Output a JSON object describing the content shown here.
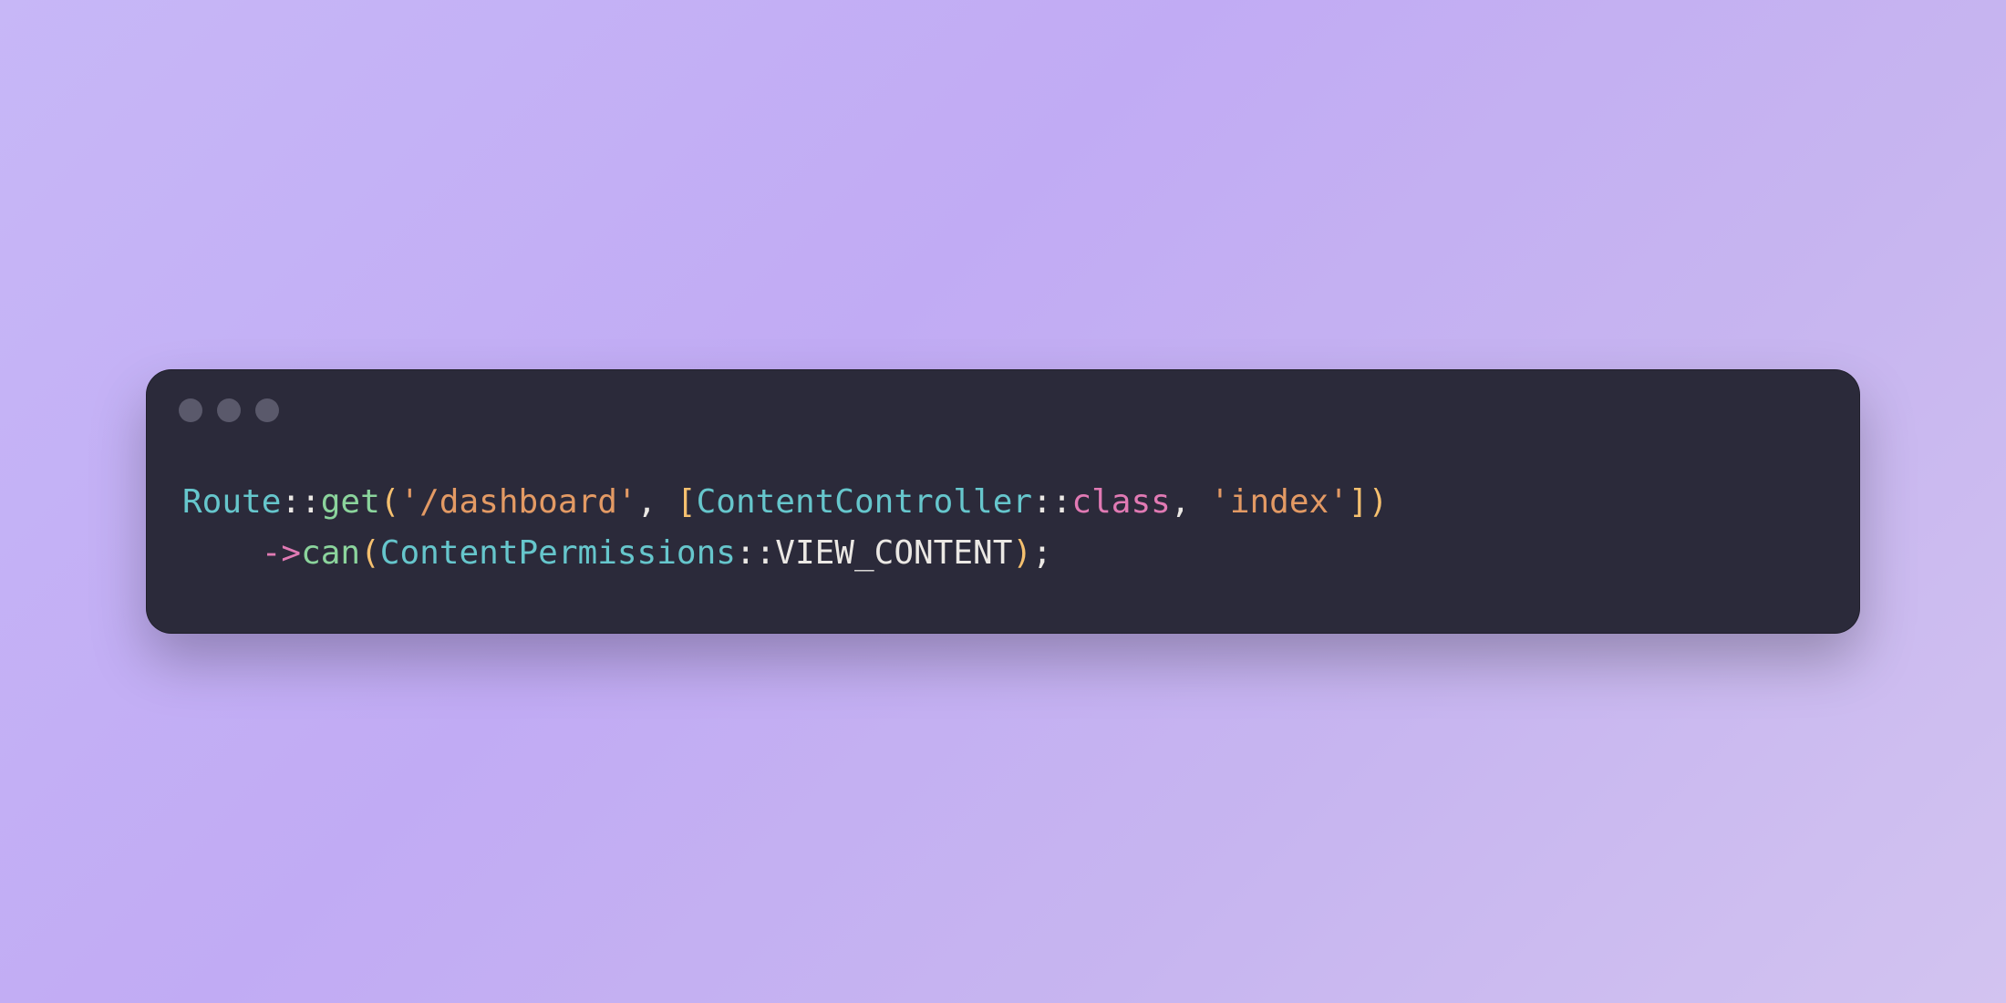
{
  "code": {
    "line1": {
      "route": "Route",
      "sep1": "::",
      "get": "get",
      "open1": "(",
      "str1": "'/dashboard'",
      "comma1": ", ",
      "lbrack": "[",
      "controller": "ContentController",
      "sep2": "::",
      "classkw": "class",
      "comma2": ", ",
      "str2": "'index'",
      "rbrack": "]",
      "close1": ")"
    },
    "line2": {
      "indent": "    ",
      "arrow": "->",
      "can": "can",
      "open2": "(",
      "perms": "ContentPermissions",
      "sep3": "::",
      "const": "VIEW_CONTENT",
      "close2": ")",
      "semi": ";"
    }
  }
}
